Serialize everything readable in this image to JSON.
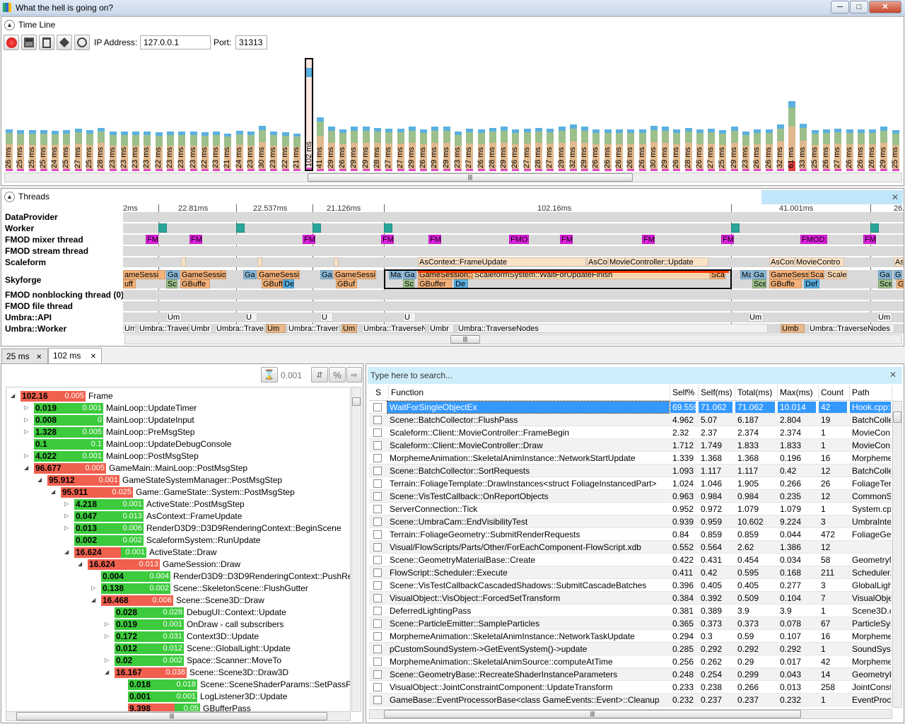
{
  "window": {
    "title": "What the hell is going on?",
    "min": "─",
    "max": "□",
    "close": "✕"
  },
  "timeline": {
    "title": "Time Line",
    "ip_label": "IP Address:",
    "ip_value": "127.0.0.1",
    "port_label": "Port:",
    "port_value": "31313",
    "frames": [
      "26",
      "25",
      "25",
      "25",
      "24",
      "25",
      "27",
      "25",
      "28",
      "23",
      "23",
      "23",
      "23",
      "22",
      "23",
      "23",
      "23",
      "22",
      "23",
      "21",
      "24",
      "23",
      "30",
      "23",
      "22",
      "21",
      "102",
      "41",
      "29",
      "26",
      "29",
      "29",
      "28",
      "27",
      "27",
      "29",
      "26",
      "29",
      "29",
      "23",
      "27",
      "26",
      "28",
      "29",
      "26",
      "27",
      "28",
      "27",
      "29",
      "32",
      "29",
      "26",
      "26",
      "26",
      "26",
      "26",
      "30",
      "29",
      "26",
      "28",
      "26",
      "27",
      "25",
      "29",
      "23",
      "26",
      "26",
      "32",
      "61",
      "33",
      "25",
      "26",
      "27",
      "26",
      "26",
      "26",
      "29",
      "25"
    ]
  },
  "threads": {
    "title": "Threads",
    "markers": [
      "2ms",
      "22.81ms",
      "22.537ms",
      "21.126ms",
      "102.16ms",
      "41.001ms",
      "26."
    ],
    "names": [
      "DataProvider",
      "Worker",
      "FMOD mixer thread",
      "FMOD stream thread",
      "Scaleform",
      "Skyforge",
      "FMOD nonblocking thread (0)",
      "FMOD file thread",
      "Umbra::API",
      "Umbra::Worker"
    ],
    "scaleform_blocks": [
      "AsContext::FrameUpdate",
      "AsCo",
      "MovieController::Update",
      "AsCon",
      "MovieContro",
      "As"
    ],
    "fmod_blocks": [
      "FM",
      "FM",
      "FM",
      "FM",
      "FM",
      "FMO",
      "FM",
      "FM",
      "FM",
      "FMOD:",
      "FM"
    ],
    "sky_top": [
      "ameSessi",
      "Ga",
      "GameSessio",
      "Ga",
      "GameSessi",
      "Ga",
      "GameSessi",
      "Ma",
      "Ga",
      "GameSession::",
      "ScaleformSystem::WaitForUpdateFinish",
      "Sca",
      "Ma",
      "Ga",
      "GameSession::D",
      "Scal",
      "Scale",
      "Ga",
      "Ga"
    ],
    "sky_bottom": [
      "uff",
      "Sc",
      "GBuffe",
      "GBuff",
      "De",
      "GBuf",
      "Sc",
      "GBuffer",
      "De",
      "Sce",
      "GBuffe",
      "Def",
      "Sce",
      "GE"
    ],
    "umbra_api": [
      "Um",
      "U",
      "U",
      "U",
      "Um",
      "Um"
    ],
    "umbra_worker": [
      "Um",
      "Umbra::Traver",
      "Umbr",
      "Umbra::Traver",
      "Um",
      "Umbra::Travers",
      "Um",
      "Umbra::TraverseN",
      "Umbr",
      "Umbra::TraverseNodes",
      "Umb",
      "Umbra::TraverseNodes"
    ]
  },
  "tabs": [
    {
      "label": "25 ms",
      "close": "✕"
    },
    {
      "label": "102 ms",
      "close": "✕"
    }
  ],
  "filter": {
    "value": "0.001",
    "pct": "%"
  },
  "tree": [
    {
      "d": 0,
      "a": "102.16",
      "b": "0.005",
      "f": "Frame",
      "ar": "red",
      "br": "red",
      "ex": "◢"
    },
    {
      "d": 1,
      "a": "0.019",
      "b": "0.001",
      "f": "MainLoop::UpdateTimer",
      "ar": "grn",
      "br": "grn",
      "ex": "▷"
    },
    {
      "d": 1,
      "a": "0.008",
      "b": "0",
      "f": "MainLoop::UpdateInput",
      "ar": "grn",
      "br": "grn",
      "ex": "▷"
    },
    {
      "d": 1,
      "a": "1.328",
      "b": "0.005",
      "f": "MainLoop::PreMsgStep",
      "ar": "grn",
      "br": "grn",
      "ex": "▷"
    },
    {
      "d": 1,
      "a": "0.1",
      "b": "0.1",
      "f": "MainLoop::UpdateDebugConsole",
      "ar": "grn",
      "br": "grn",
      "ex": ""
    },
    {
      "d": 1,
      "a": "4.022",
      "b": "0.001",
      "f": "MainLoop::PostMsgStep",
      "ar": "grn",
      "br": "grn",
      "ex": "▷"
    },
    {
      "d": 1,
      "a": "96.677",
      "b": "0.005",
      "f": "GameMain::MainLoop::PostMsgStep",
      "ar": "red",
      "br": "red",
      "ex": "◢"
    },
    {
      "d": 2,
      "a": "95.912",
      "b": "0.001",
      "f": "GameStateSystemManager::PostMsgStep",
      "ar": "red",
      "br": "red",
      "ex": "◢"
    },
    {
      "d": 3,
      "a": "95.911",
      "b": "0.025",
      "f": "Game::GameState::System::PostMsgStep",
      "ar": "red",
      "br": "red",
      "ex": "◢"
    },
    {
      "d": 4,
      "a": "4.218",
      "b": "0.001",
      "f": "ActiveState::PostMsgStep",
      "ar": "grn",
      "br": "grn",
      "ex": "▷"
    },
    {
      "d": 4,
      "a": "0.047",
      "b": "0.013",
      "f": "AsContext::FrameUpdate",
      "ar": "grn",
      "br": "grn",
      "ex": "▷"
    },
    {
      "d": 4,
      "a": "0.013",
      "b": "0.006",
      "f": "RenderD3D9::D3D9RenderingContext::BeginScene",
      "ar": "grn",
      "br": "grn",
      "ex": "▷"
    },
    {
      "d": 4,
      "a": "0.002",
      "b": "0.002",
      "f": "ScaleformSystem::RunUpdate",
      "ar": "grn",
      "br": "grn",
      "ex": ""
    },
    {
      "d": 4,
      "a": "16.624",
      "b": "0.001",
      "f": "ActiveState::Draw",
      "ar": "red",
      "br": "grn",
      "ex": "◢"
    },
    {
      "d": 5,
      "a": "16.624",
      "b": "0.013",
      "f": "GameSession::Draw",
      "ar": "red",
      "br": "red",
      "ex": "◢"
    },
    {
      "d": 6,
      "a": "0.004",
      "b": "0.004",
      "f": "RenderD3D9::D3D9RenderingContext::PushRende",
      "ar": "grn",
      "br": "grn",
      "ex": ""
    },
    {
      "d": 6,
      "a": "0.138",
      "b": "0.002",
      "f": "Scene::SkeletonScene::FlushGutter",
      "ar": "grn",
      "br": "grn",
      "ex": "▷"
    },
    {
      "d": 6,
      "a": "16.468",
      "b": "0.006",
      "f": "Scene::Scene3D::Draw",
      "ar": "red",
      "br": "red",
      "ex": "◢"
    },
    {
      "d": 7,
      "a": "0.028",
      "b": "0.028",
      "f": "DebugUI::Context::Update",
      "ar": "grn",
      "br": "grn",
      "ex": ""
    },
    {
      "d": 7,
      "a": "0.019",
      "b": "0.001",
      "f": "OnDraw - call subscribers",
      "ar": "grn",
      "br": "grn",
      "ex": "▷"
    },
    {
      "d": 7,
      "a": "0.172",
      "b": "0.031",
      "f": "Context3D::Update",
      "ar": "grn",
      "br": "grn",
      "ex": "▷"
    },
    {
      "d": 7,
      "a": "0.012",
      "b": "0.012",
      "f": "Scene::GlobalLight::Update",
      "ar": "grn",
      "br": "grn",
      "ex": ""
    },
    {
      "d": 7,
      "a": "0.02",
      "b": "0.002",
      "f": "Space::Scanner::MoveTo",
      "ar": "grn",
      "br": "grn",
      "ex": "▷"
    },
    {
      "d": 7,
      "a": "16.167",
      "b": "0.038",
      "f": "Scene::Scene3D::Draw3D",
      "ar": "red",
      "br": "red",
      "ex": "◢"
    },
    {
      "d": 8,
      "a": "0.018",
      "b": "0.018",
      "f": "Scene::SceneShaderParams::SetPassParam",
      "ar": "grn",
      "br": "grn",
      "ex": ""
    },
    {
      "d": 8,
      "a": "0.001",
      "b": "0.001",
      "f": "LogListener3D::Update",
      "ar": "grn",
      "br": "grn",
      "ex": ""
    },
    {
      "d": 8,
      "a": "9.398",
      "b": "0.05",
      "f": "GBufferPass",
      "ar": "red",
      "br": "grn",
      "ex": ""
    }
  ],
  "search": {
    "placeholder": "Type here to search...",
    "close": "✕"
  },
  "grid": {
    "headers": [
      "S",
      "Function",
      "Self%",
      "Self(ms)",
      "Total(ms)",
      "Max(ms)",
      "Count",
      "Path"
    ],
    "rows": [
      [
        "WaitForSingleObjectEx",
        "69.559",
        "71.062",
        "71.062",
        "10.014",
        "42",
        "Hook.cpp:"
      ],
      [
        "Scene::BatchCollector::FlushPass",
        "4.962",
        "5.07",
        "6.187",
        "2.804",
        "19",
        "BatchColle"
      ],
      [
        "Scaleform::Client::MovieController::FrameBegin",
        "2.32",
        "2.37",
        "2.374",
        "2.374",
        "1",
        "MovieCon"
      ],
      [
        "Scaleform::Client::MovieController::Draw",
        "1.712",
        "1.749",
        "1.833",
        "1.833",
        "1",
        "MovieCon"
      ],
      [
        "MorphemeAnimation::SkeletalAnimInstance::NetworkStartUpdate",
        "1.339",
        "1.368",
        "1.368",
        "0.196",
        "16",
        "Morpheme"
      ],
      [
        "Scene::BatchCollector::SortRequests",
        "1.093",
        "1.117",
        "1.117",
        "0.42",
        "12",
        "BatchColle"
      ],
      [
        "Terrain::FoliageTemplate::DrawInstances<struct FoliageInstancedPart>",
        "1.024",
        "1.046",
        "1.905",
        "0.266",
        "26",
        "FoliageTer"
      ],
      [
        "Scene::VisTestCallback::OnReportObjects",
        "0.963",
        "0.984",
        "0.984",
        "0.235",
        "12",
        "CommonS"
      ],
      [
        "ServerConnection::Tick",
        "0.952",
        "0.972",
        "1.079",
        "1.079",
        "1",
        "System.cp"
      ],
      [
        "Scene::UmbraCam::EndVisibilityTest",
        "0.939",
        "0.959",
        "10.602",
        "9.224",
        "3",
        "UmbraInte"
      ],
      [
        "Terrain::FoliageGeometry::SubmitRenderRequests",
        "0.84",
        "0.859",
        "0.859",
        "0.044",
        "472",
        "FoliageGe"
      ],
      [
        "Visual/FlowScripts/Parts/Other/ForEachComponent-FlowScript.xdb",
        "0.552",
        "0.564",
        "2.62",
        "1.386",
        "12",
        ""
      ],
      [
        "Scene::GeometryMaterialBase::Create",
        "0.422",
        "0.431",
        "0.454",
        "0.034",
        "58",
        "GeometryM"
      ],
      [
        "FlowScript::Scheduler::Execute",
        "0.411",
        "0.42",
        "0.595",
        "0.168",
        "211",
        "Scheduler."
      ],
      [
        "Scene::VisTestCallbackCascadedShadows::SubmitCascadeBatches",
        "0.396",
        "0.405",
        "0.405",
        "0.277",
        "3",
        "GlobalLigh"
      ],
      [
        "VisualObject::VisObject::ForcedSetTransform",
        "0.384",
        "0.392",
        "0.509",
        "0.104",
        "7",
        "VisualObje"
      ],
      [
        "DeferredLightingPass",
        "0.381",
        "0.389",
        "3.9",
        "3.9",
        "1",
        "Scene3D.c"
      ],
      [
        "Scene::ParticleEmitter::SampleParticles",
        "0.365",
        "0.373",
        "0.373",
        "0.078",
        "67",
        "ParticleSys"
      ],
      [
        "MorphemeAnimation::SkeletalAnimInstance::NetworkTaskUpdate",
        "0.294",
        "0.3",
        "0.59",
        "0.107",
        "16",
        "Morpheme"
      ],
      [
        "pCustomSoundSystem->GetEventSystem()->update",
        "0.285",
        "0.292",
        "0.292",
        "0.292",
        "1",
        "SoundSyst"
      ],
      [
        "MorphemeAnimation::SkeletalAnimSource::computeAtTime",
        "0.256",
        "0.262",
        "0.29",
        "0.017",
        "42",
        "Morpheme"
      ],
      [
        "Scene::GeometryBase::RecreateShaderInstanceParameters",
        "0.248",
        "0.254",
        "0.299",
        "0.043",
        "14",
        "GeometryI"
      ],
      [
        "VisualObject::JointConstraintComponent::UpdateTransform",
        "0.233",
        "0.238",
        "0.266",
        "0.013",
        "258",
        "JointConst"
      ],
      [
        "GameBase::EventProcessorBase<class GameEvents::Event>::Cleanup",
        "0.232",
        "0.237",
        "0.237",
        "0.232",
        "1",
        "EventProc"
      ]
    ]
  },
  "colors": {
    "red": "#f0604e",
    "green": "#3ccb3c",
    "sel": "#3399ff",
    "search_bg": "#cfeefc"
  }
}
